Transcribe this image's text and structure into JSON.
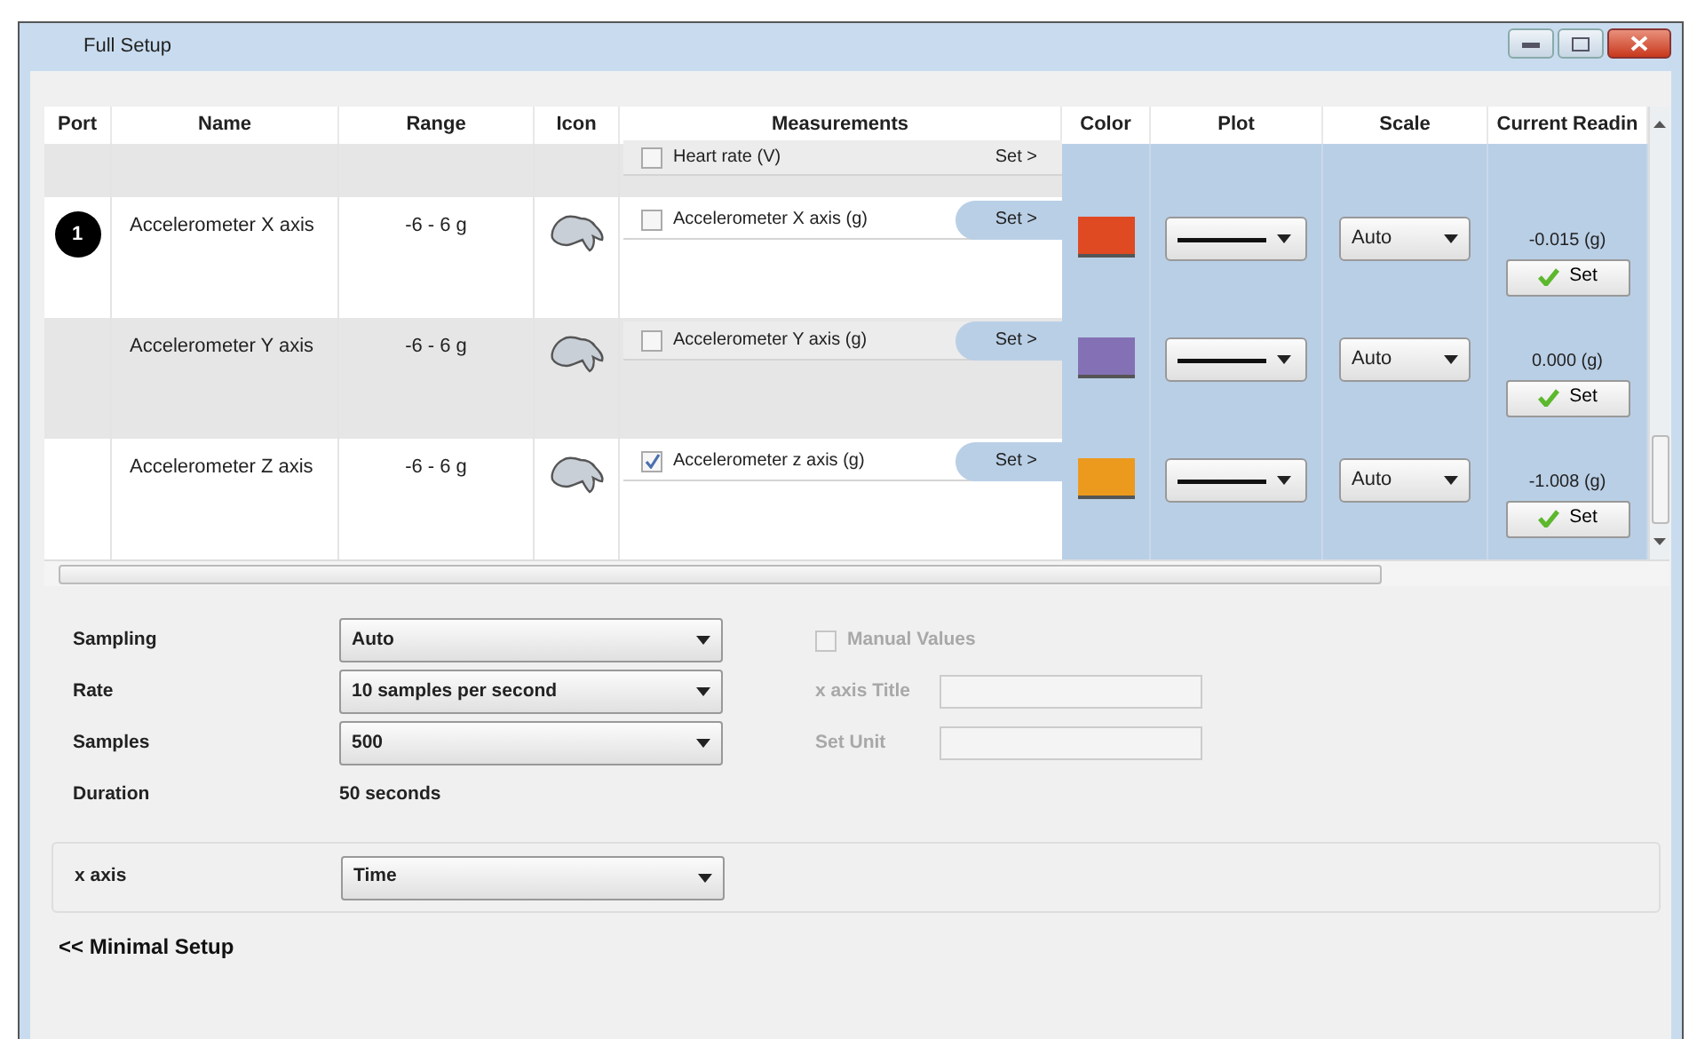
{
  "window": {
    "title": "Full Setup"
  },
  "table": {
    "columns": [
      "Port",
      "Name",
      "Range",
      "Icon",
      "Measurements",
      "Color",
      "Plot",
      "Scale",
      "Current Readin"
    ],
    "rows": [
      {
        "kind": "partial",
        "shaded": true,
        "measurement": "Heart rate (V)",
        "checked": false,
        "set_link": "Set >"
      },
      {
        "kind": "sensor",
        "shaded": false,
        "port": "1",
        "name": "Accelerometer X axis",
        "range": "-6 - 6 g",
        "measurement": "Accelerometer X axis (g)",
        "checked": false,
        "set_link": "Set >",
        "color": "#e04a22",
        "scale": "Auto",
        "reading": "-0.015 (g)",
        "set_button": "Set"
      },
      {
        "kind": "sensor",
        "shaded": true,
        "name": "Accelerometer Y axis",
        "range": "-6 - 6 g",
        "measurement": "Accelerometer Y axis (g)",
        "checked": false,
        "set_link": "Set >",
        "color": "#8470b4",
        "scale": "Auto",
        "reading": "0.000 (g)",
        "set_button": "Set"
      },
      {
        "kind": "sensor",
        "shaded": false,
        "name": "Accelerometer Z axis",
        "range": "-6 - 6 g",
        "measurement": "Accelerometer z axis  (g)",
        "checked": true,
        "set_link": "Set >",
        "color": "#ec9a1e",
        "scale": "Auto",
        "reading": "-1.008 (g)",
        "set_button": "Set"
      }
    ]
  },
  "settings": [
    {
      "kind": "select",
      "label": "Sampling",
      "value": "Auto"
    },
    {
      "kind": "select",
      "label": "Rate",
      "value": "10 samples per second"
    },
    {
      "kind": "select",
      "label": "Samples",
      "value": "500"
    },
    {
      "kind": "text",
      "label": "Duration",
      "value": "50 seconds"
    }
  ],
  "manual": {
    "label": "Manual Values",
    "checked": false,
    "disabled": true
  },
  "manual_fields": [
    {
      "label": "x axis Title",
      "disabled": true
    },
    {
      "label": "Set Unit",
      "disabled": true
    }
  ],
  "x_axis": {
    "label": "x axis",
    "value": "Time"
  },
  "footer_link": "<< Minimal Setup"
}
